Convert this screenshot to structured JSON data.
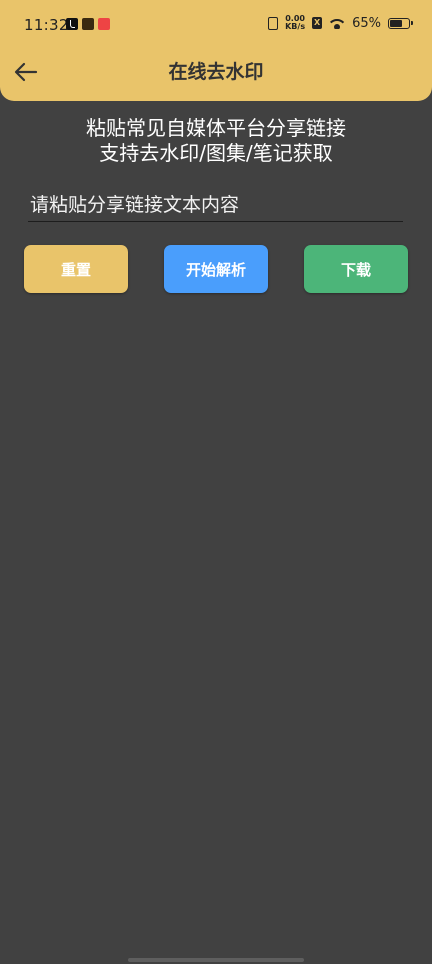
{
  "status_bar": {
    "time": "11:32",
    "netspeed_value": "0.00",
    "netspeed_unit": "KB/s",
    "sim_label": "X",
    "battery_percent": "65%",
    "battery_level": 0.65
  },
  "header": {
    "title": "在线去水印",
    "background_color": "#e9c46a"
  },
  "intro": {
    "line1": "粘贴常见自媒体平台分享链接",
    "line2": "支持去水印/图集/笔记获取"
  },
  "link_input": {
    "value": "",
    "placeholder": "请粘贴分享链接文本内容"
  },
  "buttons": {
    "reset_label": "重置",
    "parse_label": "开始解析",
    "download_label": "下载",
    "reset_color": "#e9c46a",
    "parse_color": "#4a9efc",
    "download_color": "#4cb579"
  }
}
